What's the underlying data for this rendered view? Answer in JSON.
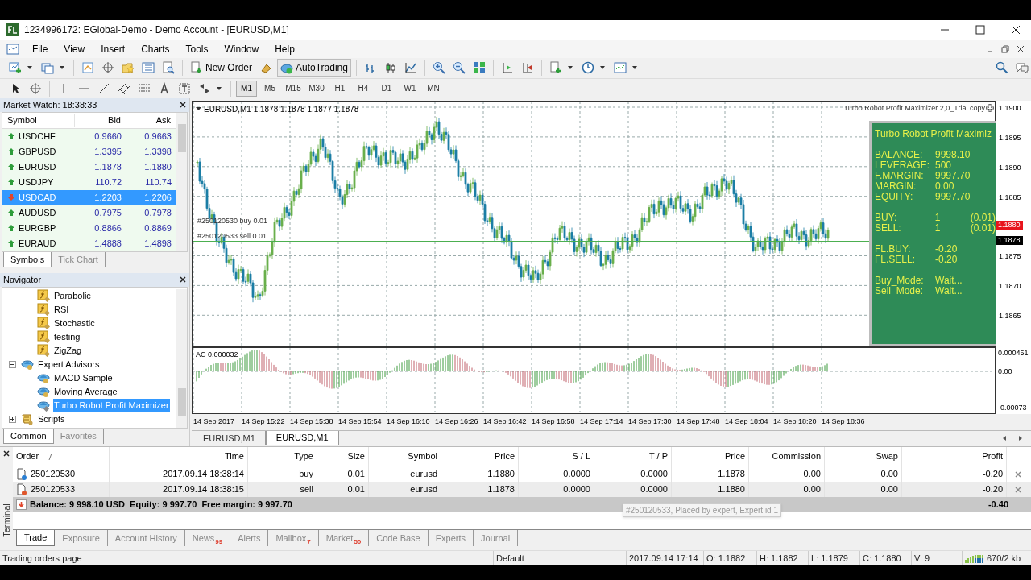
{
  "window": {
    "title": "1234996172: EGlobal-Demo - Demo Account - [EURUSD,M1]"
  },
  "menu": [
    "File",
    "View",
    "Insert",
    "Charts",
    "Tools",
    "Window",
    "Help"
  ],
  "toolbar": {
    "buttons": [
      {
        "label": "New Order"
      },
      {
        "label": "AutoTrading"
      }
    ]
  },
  "timeframes": [
    {
      "label": "M1",
      "selected": true
    },
    {
      "label": "M5",
      "selected": false
    },
    {
      "label": "M15",
      "selected": false
    },
    {
      "label": "M30",
      "selected": false
    },
    {
      "label": "H1",
      "selected": false
    },
    {
      "label": "H4",
      "selected": false
    },
    {
      "label": "D1",
      "selected": false
    },
    {
      "label": "W1",
      "selected": false
    },
    {
      "label": "MN",
      "selected": false
    }
  ],
  "market_watch": {
    "title": "Market Watch: 18:38:33",
    "columns": [
      "Symbol",
      "Bid",
      "Ask"
    ],
    "rows": [
      {
        "symbol": "USDCHF",
        "bid": "0.9660",
        "ask": "0.9663",
        "rising": true,
        "selected": false
      },
      {
        "symbol": "GBPUSD",
        "bid": "1.3395",
        "ask": "1.3398",
        "rising": true,
        "selected": false
      },
      {
        "symbol": "EURUSD",
        "bid": "1.1878",
        "ask": "1.1880",
        "rising": true,
        "selected": false
      },
      {
        "symbol": "USDJPY",
        "bid": "110.72",
        "ask": "110.74",
        "rising": true,
        "selected": false
      },
      {
        "symbol": "USDCAD",
        "bid": "1.2203",
        "ask": "1.2206",
        "rising": false,
        "selected": true
      },
      {
        "symbol": "AUDUSD",
        "bid": "0.7975",
        "ask": "0.7978",
        "rising": true,
        "selected": false
      },
      {
        "symbol": "EURGBP",
        "bid": "0.8866",
        "ask": "0.8869",
        "rising": true,
        "selected": false
      },
      {
        "symbol": "EURAUD",
        "bid": "1.4888",
        "ask": "1.4898",
        "rising": true,
        "selected": false
      }
    ],
    "tabs": [
      {
        "label": "Symbols",
        "selected": true
      },
      {
        "label": "Tick Chart",
        "selected": false
      }
    ]
  },
  "navigator": {
    "title": "Navigator",
    "tree": [
      {
        "kind": "continued",
        "children": [
          {
            "kind": "indicator",
            "label": "Parabolic",
            "selected": false
          },
          {
            "kind": "indicator",
            "label": "RSI",
            "selected": false
          },
          {
            "kind": "indicator",
            "label": "Stochastic",
            "selected": false
          },
          {
            "kind": "indicator",
            "label": "testing",
            "selected": false
          },
          {
            "kind": "indicator",
            "label": "ZigZag",
            "selected": false
          }
        ]
      },
      {
        "kind": "expert",
        "label": "Expert Advisors",
        "expanded": true,
        "selected": false,
        "children": [
          {
            "kind": "expert",
            "label": "MACD Sample",
            "selected": false
          },
          {
            "kind": "expert",
            "label": "Moving Average",
            "selected": false
          },
          {
            "kind": "expert_item",
            "label": "Turbo Robot Profit Maximizer",
            "selected": true
          }
        ]
      },
      {
        "kind": "script",
        "label": "Scripts",
        "expanded": false,
        "selected": false
      }
    ],
    "tabs": [
      {
        "label": "Common",
        "selected": true
      },
      {
        "label": "Favorites",
        "selected": false
      }
    ]
  },
  "chart": {
    "header": "EURUSD,M1  1.1878 1.1878 1.1877 1.1878",
    "ea_label": "Turbo Robot Profit Maximizer 2,0_Trial copy",
    "trade_lines": [
      {
        "label": "#250120530 buy 0.01",
        "color": "#c0392b"
      },
      {
        "label": "#250120533 sell 0.01",
        "color": "#4caf50"
      }
    ],
    "price_ticks": [
      "1.1900",
      "1.1895",
      "1.1890",
      "1.1885",
      "1.1875",
      "1.1870",
      "1.1865"
    ],
    "price_tags": [
      {
        "label": "1.1880",
        "color": "#e8141c"
      },
      {
        "label": "1.1878",
        "color": "#000000"
      }
    ],
    "panel": {
      "title": "Turbo Robot Profit Maximiz",
      "groups": [
        [
          {
            "label": "BALANCE:",
            "value": "9998.10"
          },
          {
            "label": "LEVERAGE:",
            "value": "500"
          },
          {
            "label": "F.MARGIN:",
            "value": "9997.70"
          },
          {
            "label": "MARGIN:",
            "value": "0.00"
          },
          {
            "label": "EQUITY:",
            "value": "9997.70"
          }
        ],
        [
          {
            "label": "BUY:",
            "value": "1",
            "extra": "(0.01)"
          },
          {
            "label": "SELL:",
            "value": "1",
            "extra": "(0.01)"
          }
        ],
        [
          {
            "label": "FL.BUY:",
            "value": "-0.20"
          },
          {
            "label": "FL.SELL:",
            "value": "-0.20"
          }
        ],
        [
          {
            "label": "Buy_Mode:",
            "value": "Wait..."
          },
          {
            "label": "Sell_Mode:",
            "value": "Wait..."
          }
        ]
      ]
    },
    "indicator": {
      "label": "AC 0.000032",
      "ticks": [
        "0.000451",
        "0.00",
        "-0.00073"
      ]
    },
    "time_ticks": [
      "14 Sep 2017",
      "14 Sep 15:22",
      "14 Sep 15:38",
      "14 Sep 15:54",
      "14 Sep 16:10",
      "14 Sep 16:26",
      "14 Sep 16:42",
      "14 Sep 16:58",
      "14 Sep 17:14",
      "14 Sep 17:30",
      "14 Sep 17:48",
      "14 Sep 18:04",
      "14 Sep 18:20",
      "14 Sep 18:36"
    ],
    "tabs": [
      {
        "label": "EURUSD,M1",
        "selected": false
      },
      {
        "label": "EURUSD,M1",
        "selected": true
      }
    ]
  },
  "terminal": {
    "label": "Terminal",
    "columns": [
      "Order",
      "Time",
      "Type",
      "Size",
      "Symbol",
      "Price",
      "S / L",
      "T / P",
      "Price",
      "Commission",
      "Swap",
      "Profit"
    ],
    "rows": [
      {
        "kind": "buy",
        "cells": [
          "250120530",
          "2017.09.14 18:38:14",
          "buy",
          "0.01",
          "eurusd",
          "1.1880",
          "0.0000",
          "0.0000",
          "1.1878",
          "0.00",
          "0.00",
          "-0.20"
        ]
      },
      {
        "kind": "sell",
        "cells": [
          "250120533",
          "2017.09.14 18:38:15",
          "sell",
          "0.01",
          "eurusd",
          "1.1878",
          "0.0000",
          "0.0000",
          "1.1880",
          "0.00",
          "0.00",
          "-0.20"
        ]
      }
    ],
    "summary": {
      "text": "Balance: 9 998.10 USD  Equity: 9 997.70  Free margin: 9 997.70",
      "profit": "-0.40"
    },
    "tooltip": "#250120533, Placed by expert, Expert id 1",
    "tabs": [
      {
        "label": "Trade",
        "selected": true
      },
      {
        "label": "Exposure",
        "selected": false
      },
      {
        "label": "Account History",
        "selected": false
      },
      {
        "label": "News",
        "badge": "99",
        "selected": false
      },
      {
        "label": "Alerts",
        "selected": false
      },
      {
        "label": "Mailbox",
        "badge": "7",
        "selected": false
      },
      {
        "label": "Market",
        "badge": "50",
        "selected": false
      },
      {
        "label": "Code Base",
        "selected": false
      },
      {
        "label": "Experts",
        "selected": false
      },
      {
        "label": "Journal",
        "selected": false
      }
    ]
  },
  "status_bar": [
    "Trading orders page",
    "Default",
    "2017.09.14 17:14",
    "O: 1.1882",
    "H: 1.1882",
    "L: 1.1879",
    "C: 1.1880",
    "V: 9",
    "670/2 kb"
  ]
}
